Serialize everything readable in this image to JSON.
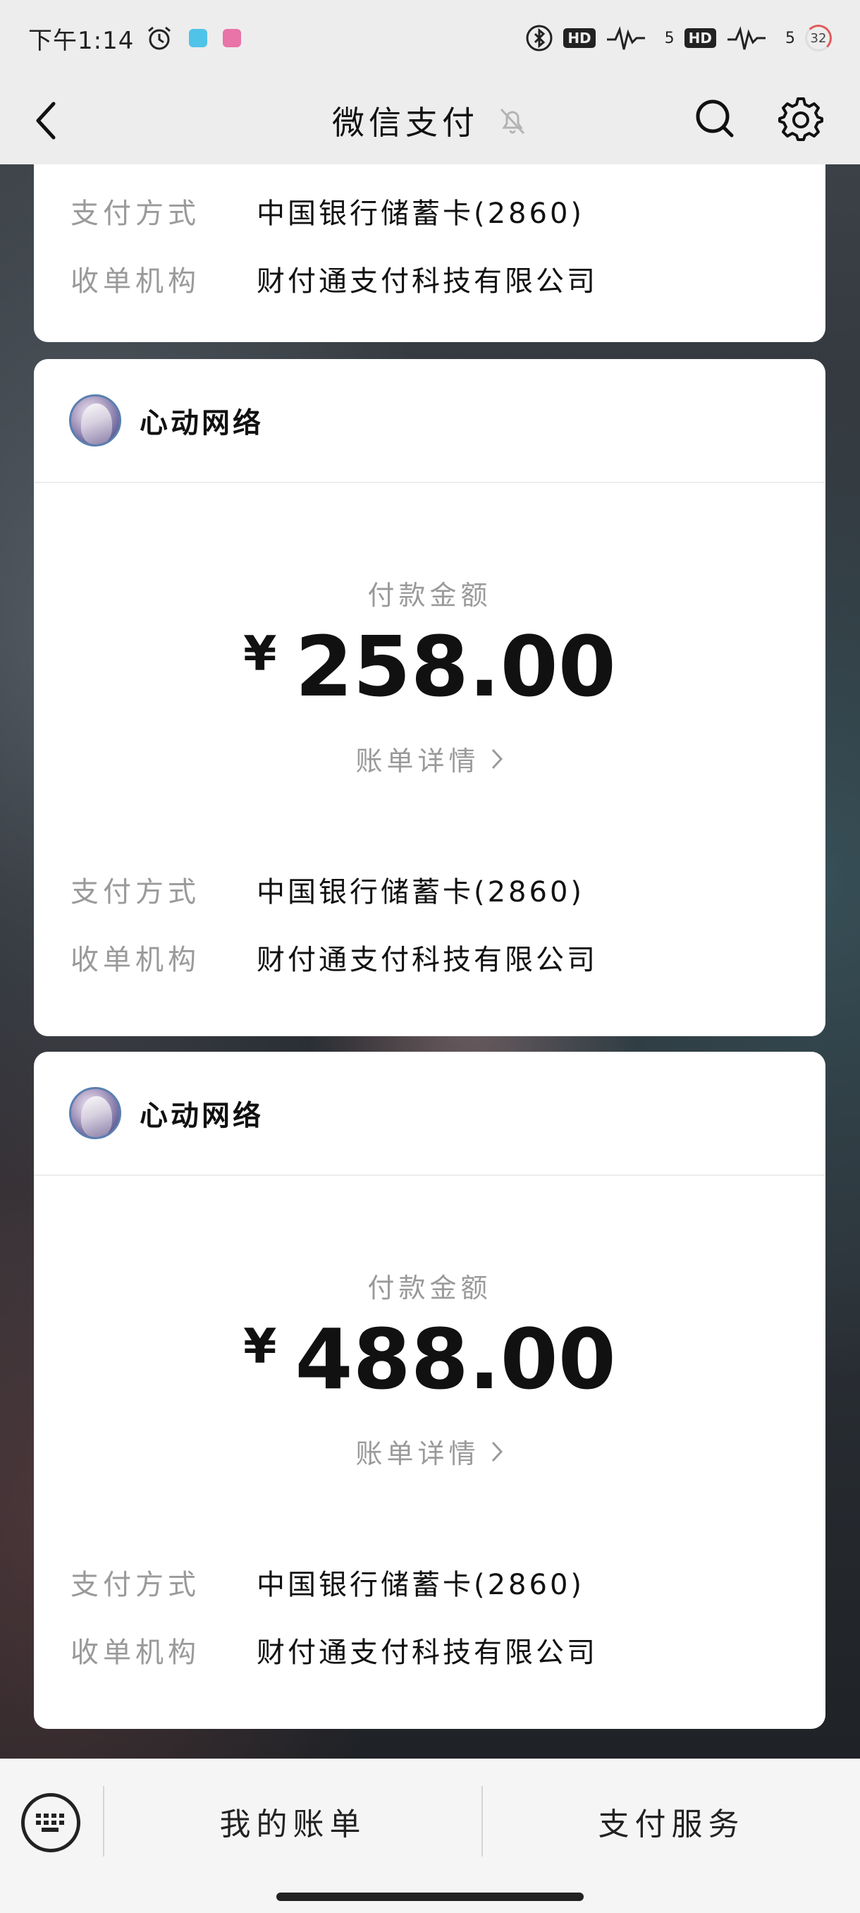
{
  "status_bar": {
    "time": "下午1:14",
    "battery": "32",
    "network_1": "5",
    "network_2": "5",
    "hd": "HD"
  },
  "nav": {
    "title": "微信支付"
  },
  "partial_card": {
    "rows": [
      {
        "label": "支付方式",
        "value": "中国银行储蓄卡(2860)"
      },
      {
        "label": "收单机构",
        "value": "财付通支付科技有限公司"
      }
    ]
  },
  "cards": [
    {
      "merchant": "心动网络",
      "amount_label": "付款金额",
      "currency": "¥",
      "amount": "258.00",
      "detail_link": "账单详情",
      "rows": [
        {
          "label": "支付方式",
          "value": "中国银行储蓄卡(2860)"
        },
        {
          "label": "收单机构",
          "value": "财付通支付科技有限公司"
        }
      ]
    },
    {
      "merchant": "心动网络",
      "amount_label": "付款金额",
      "currency": "¥",
      "amount": "488.00",
      "detail_link": "账单详情",
      "rows": [
        {
          "label": "支付方式",
          "value": "中国银行储蓄卡(2860)"
        },
        {
          "label": "收单机构",
          "value": "财付通支付科技有限公司"
        }
      ]
    }
  ],
  "bottom_menu": {
    "item_1": "我的账单",
    "item_2": "支付服务"
  },
  "icons": {
    "back": "chevron-left-icon",
    "mute": "bell-off-icon",
    "search": "search-icon",
    "settings": "gear-icon",
    "keyboard": "keyboard-icon"
  }
}
